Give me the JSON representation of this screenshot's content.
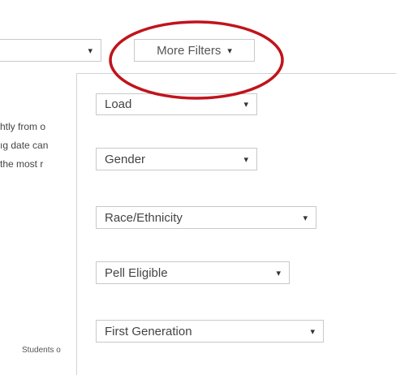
{
  "top_select": {
    "value": "",
    "caret": "▾"
  },
  "more_filters": {
    "label": "More Filters",
    "caret": "▾"
  },
  "background_text": {
    "lines": [
      "htly from o",
      "ıg date can",
      " the most r"
    ],
    "footnote": "Students o"
  },
  "filters": [
    {
      "label": "Load",
      "caret": "▾"
    },
    {
      "label": "Gender",
      "caret": "▾"
    },
    {
      "label": "Race/Ethnicity",
      "caret": "▾"
    },
    {
      "label": "Pell Eligible",
      "caret": "▾"
    },
    {
      "label": "First Generation",
      "caret": "▾"
    }
  ],
  "annotation": {
    "color": "#c0141c"
  }
}
